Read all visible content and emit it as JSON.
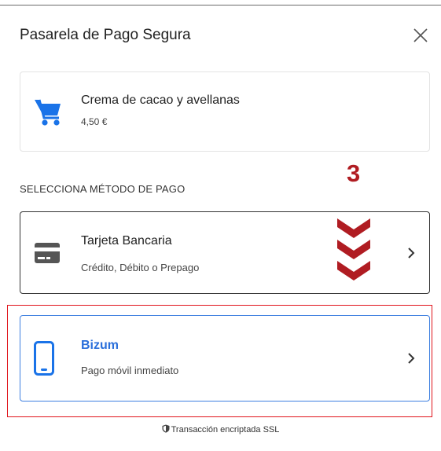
{
  "header": {
    "title": "Pasarela de Pago Segura",
    "close_icon": "close-icon"
  },
  "product": {
    "name": "Crema de cacao y avellanas",
    "price": "4,50 €",
    "icon": "cart-icon"
  },
  "payment": {
    "section_label": "SELECCIONA MÉTODO DE PAGO",
    "methods": [
      {
        "title": "Tarjeta Bancaria",
        "subtitle": "Crédito, Débito o Prepago",
        "icon": "credit-card-icon"
      },
      {
        "title": "Bizum",
        "subtitle": "Pago móvil inmediato",
        "icon": "smartphone-icon"
      }
    ]
  },
  "annotation": {
    "step": "3",
    "color": "#b01c22",
    "highlight_color": "#e0141b"
  },
  "footer": {
    "ssl_text": "Transacción encriptada SSL",
    "icon": "shield-icon"
  },
  "colors": {
    "accent": "#2a6fdb",
    "text": "#222222"
  }
}
